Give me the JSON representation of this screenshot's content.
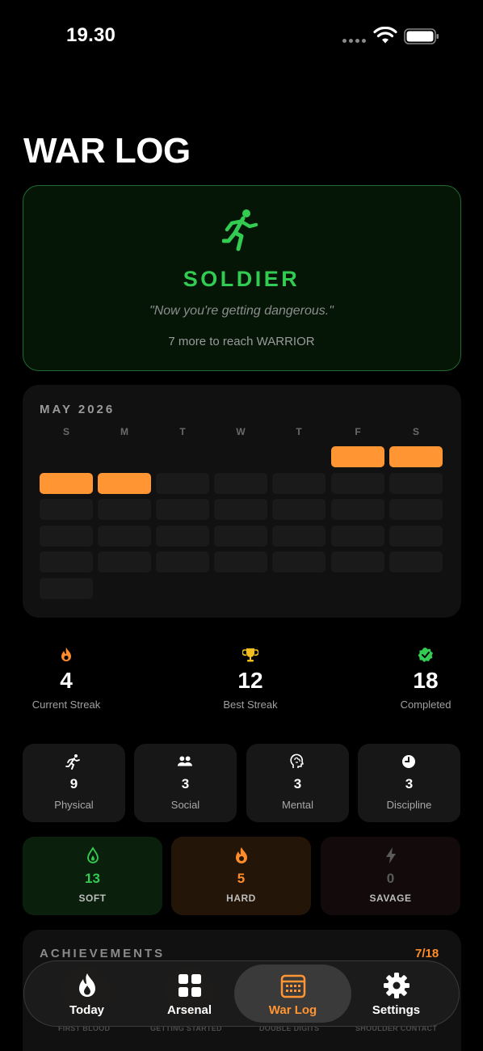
{
  "status_bar": {
    "time": "19.30"
  },
  "page": {
    "title": "WAR LOG"
  },
  "rank": {
    "name": "SOLDIER",
    "quote": "\"Now you're getting dangerous.\"",
    "progress_text": "7 more to reach WARRIOR",
    "accent_color": "#33cc52",
    "icon": "running-figure-icon"
  },
  "calendar": {
    "month_label": "MAY 2026",
    "weekdays": [
      "S",
      "M",
      "T",
      "W",
      "T",
      "F",
      "S"
    ],
    "active_color": "#ff9533",
    "weeks": [
      [
        null,
        null,
        null,
        null,
        null,
        true,
        true
      ],
      [
        true,
        true,
        false,
        false,
        false,
        false,
        false
      ],
      [
        false,
        false,
        false,
        false,
        false,
        false,
        false
      ],
      [
        false,
        false,
        false,
        false,
        false,
        false,
        false
      ],
      [
        false,
        false,
        false,
        false,
        false,
        false,
        false
      ],
      [
        false,
        null,
        null,
        null,
        null,
        null,
        null
      ]
    ]
  },
  "stats": [
    {
      "icon": "flame-icon",
      "value": "4",
      "label": "Current Streak"
    },
    {
      "icon": "trophy-icon",
      "value": "12",
      "label": "Best Streak"
    },
    {
      "icon": "check-badge-icon",
      "value": "18",
      "label": "Completed"
    }
  ],
  "categories": [
    {
      "icon": "running-figure-icon",
      "value": "9",
      "label": "Physical"
    },
    {
      "icon": "people-icon",
      "value": "3",
      "label": "Social"
    },
    {
      "icon": "head-brain-icon",
      "value": "3",
      "label": "Mental"
    },
    {
      "icon": "clock-icon",
      "value": "3",
      "label": "Discipline"
    }
  ],
  "difficulty": [
    {
      "icon": "drop-flame-icon",
      "value": "13",
      "label": "SOFT",
      "color": "#33cc52",
      "bg": "#0a1f0c"
    },
    {
      "icon": "flame-icon",
      "value": "5",
      "label": "HARD",
      "color": "#ff8c2a",
      "bg": "#231608"
    },
    {
      "icon": "bolt-icon",
      "value": "0",
      "label": "SAVAGE",
      "color": "#5a5a5a",
      "bg": "#130b0b"
    }
  ],
  "achievements": {
    "title": "ACHIEVEMENTS",
    "count": "7/18",
    "items": [
      "FIRST BLOOD",
      "GETTING STARTED",
      "DOUBLE DIGITS",
      "SHOULDER CONTACT"
    ]
  },
  "tabs": [
    {
      "label": "Today",
      "icon": "flame-icon",
      "selected": false
    },
    {
      "label": "Arsenal",
      "icon": "grid-icon",
      "selected": false
    },
    {
      "label": "War Log",
      "icon": "calendar-icon",
      "selected": true
    },
    {
      "label": "Settings",
      "icon": "gear-icon",
      "selected": false
    }
  ]
}
